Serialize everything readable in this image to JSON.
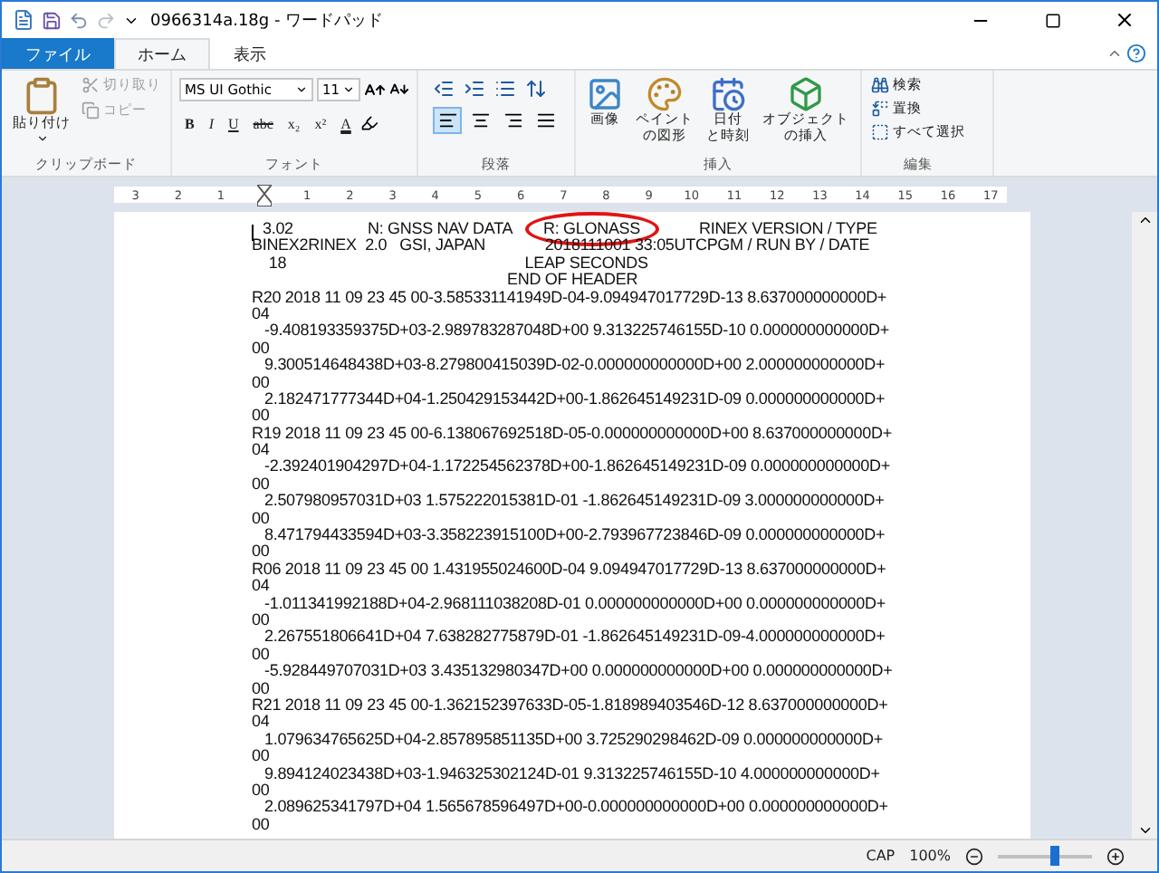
{
  "window": {
    "title": "0966314a.18g - ワードパッド"
  },
  "tabs": [
    {
      "label": "ファイル",
      "kind": "file",
      "selected": false
    },
    {
      "label": "ホーム",
      "kind": "tab",
      "selected": true
    },
    {
      "label": "表示",
      "kind": "tab",
      "selected": false
    }
  ],
  "ribbon": {
    "clipboard": {
      "title": "クリップボード",
      "paste": "貼り付け",
      "items": [
        {
          "label": "切り取り",
          "kind": "cut",
          "disabled": true
        },
        {
          "label": "コピー",
          "kind": "copy",
          "disabled": true
        }
      ]
    },
    "font": {
      "title": "フォント",
      "family": "MS UI Gothic",
      "size": "11",
      "format_buttons": [
        {
          "label": "B",
          "kind": "bold"
        },
        {
          "label": "I",
          "kind": "italic"
        },
        {
          "label": "U",
          "kind": "underline"
        },
        {
          "label": "abc",
          "kind": "strike"
        },
        {
          "label": "x₂",
          "kind": "sub"
        },
        {
          "label": "x²",
          "kind": "sup"
        },
        {
          "label": "A",
          "kind": "color"
        }
      ]
    },
    "paragraph": {
      "title": "段落",
      "alignments": [
        {
          "kind": "left",
          "selected": true
        },
        {
          "kind": "center",
          "selected": false
        },
        {
          "kind": "right",
          "selected": false
        },
        {
          "kind": "justify",
          "selected": false
        }
      ]
    },
    "insert": {
      "title": "挿入",
      "items": [
        {
          "lines": [
            "画像"
          ],
          "kind": "picture"
        },
        {
          "lines": [
            "ペイント",
            "の図形"
          ],
          "kind": "paint"
        },
        {
          "lines": [
            "日付",
            "と時刻"
          ],
          "kind": "date"
        },
        {
          "lines": [
            "オブジェクト",
            "の挿入"
          ],
          "kind": "object"
        }
      ]
    },
    "editing": {
      "title": "編集",
      "items": [
        {
          "label": "検索",
          "kind": "find"
        },
        {
          "label": "置換",
          "kind": "replace"
        },
        {
          "label": "すべて選択",
          "kind": "selectall"
        }
      ]
    }
  },
  "ruler": {
    "left_labels": [
      "3",
      "2",
      "1"
    ],
    "right_labels": [
      "1",
      "2",
      "3",
      "4",
      "5",
      "6",
      "7",
      "8",
      "9",
      "10",
      "11",
      "12",
      "13",
      "14",
      "15",
      "16",
      "17"
    ]
  },
  "document": {
    "lines": [
      {
        "kind": "fields",
        "fields": [
          {
            "text": "3.02",
            "circled": false
          },
          {
            "text": "N: GNSS NAV DATA",
            "circled": false
          },
          {
            "text": "R: GLONASS",
            "circled": true
          },
          {
            "text": "RINEX VERSION / TYPE",
            "circled": false
          }
        ]
      },
      {
        "kind": "header",
        "text": "BINEX2RINEX  2.0   GSI, JAPAN              2018111001 33:05UTCPGM / RUN BY / DATE"
      },
      {
        "kind": "header",
        "text": "    18                                                        LEAP SECONDS"
      },
      {
        "kind": "header",
        "text": "                                                            END OF HEADER"
      },
      {
        "kind": "record",
        "text": "R20 2018 11 09 23 45 00-3.585331141949D-04-9.094947017729D-13 8.637000000000D+"
      },
      {
        "kind": "wrap",
        "text": "04"
      },
      {
        "kind": "orbit",
        "text": "-9.408193359375D+03-2.989783287048D+00 9.313225746155D-10 0.000000000000D+"
      },
      {
        "kind": "wrap",
        "text": "00"
      },
      {
        "kind": "orbit",
        "text": "9.300514648438D+03-8.279800415039D-02-0.000000000000D+00 2.000000000000D+"
      },
      {
        "kind": "wrap",
        "text": "00"
      },
      {
        "kind": "orbit",
        "text": "2.182471777344D+04-1.250429153442D+00-1.862645149231D-09 0.000000000000D+"
      },
      {
        "kind": "wrap",
        "text": "00"
      },
      {
        "kind": "record",
        "text": "R19 2018 11 09 23 45 00-6.138067692518D-05-0.000000000000D+00 8.637000000000D+"
      },
      {
        "kind": "wrap",
        "text": "04"
      },
      {
        "kind": "orbit",
        "text": "-2.392401904297D+04-1.172254562378D+00-1.862645149231D-09 0.000000000000D+"
      },
      {
        "kind": "wrap",
        "text": "00"
      },
      {
        "kind": "orbit",
        "text": "2.507980957031D+03 1.575222015381D-01 -1.862645149231D-09 3.000000000000D+"
      },
      {
        "kind": "wrap",
        "text": "00"
      },
      {
        "kind": "orbit",
        "text": "8.471794433594D+03-3.358223915100D+00-2.793967723846D-09 0.000000000000D+"
      },
      {
        "kind": "wrap",
        "text": "00"
      },
      {
        "kind": "record",
        "text": "R06 2018 11 09 23 45 00 1.431955024600D-04 9.094947017729D-13 8.637000000000D+"
      },
      {
        "kind": "wrap",
        "text": "04"
      },
      {
        "kind": "orbit",
        "text": "-1.011341992188D+04-2.968111038208D-01 0.000000000000D+00 0.000000000000D+"
      },
      {
        "kind": "wrap",
        "text": "00"
      },
      {
        "kind": "orbit",
        "text": "2.267551806641D+04 7.638282775879D-01 -1.862645149231D-09-4.000000000000D+"
      },
      {
        "kind": "wrap",
        "text": "00"
      },
      {
        "kind": "orbit",
        "text": "-5.928449707031D+03 3.435132980347D+00 0.000000000000D+00 0.000000000000D+"
      },
      {
        "kind": "wrap",
        "text": "00"
      },
      {
        "kind": "record",
        "text": "R21 2018 11 09 23 45 00-1.362152397633D-05-1.818989403546D-12 8.637000000000D+"
      },
      {
        "kind": "wrap",
        "text": "04"
      },
      {
        "kind": "orbit",
        "text": "1.079634765625D+04-2.857895851135D+00 3.725290298462D-09 0.000000000000D+"
      },
      {
        "kind": "wrap",
        "text": "00"
      },
      {
        "kind": "orbit",
        "text": "9.894124023438D+03-1.946325302124D-01 9.313225746155D-10 4.000000000000D+"
      },
      {
        "kind": "wrap",
        "text": "00"
      },
      {
        "kind": "orbit",
        "text": "2.089625341797D+04 1.565678596497D+00-0.000000000000D+00 0.000000000000D+"
      },
      {
        "kind": "wrap",
        "text": "00"
      }
    ]
  },
  "status_bar": {
    "caps": "CAP",
    "zoom": "100%",
    "zoom_slider": {
      "level": 0.6
    }
  }
}
